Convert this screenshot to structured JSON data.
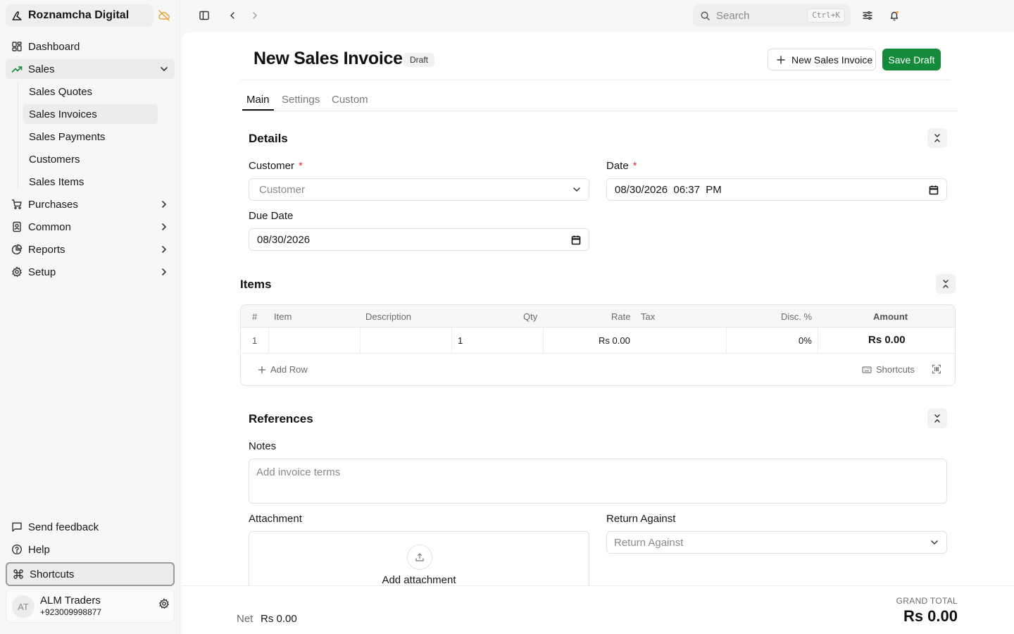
{
  "app": {
    "name": "Roznamcha Digital"
  },
  "sidebar": {
    "items": [
      {
        "label": "Dashboard"
      },
      {
        "label": "Sales"
      },
      {
        "label": "Purchases"
      },
      {
        "label": "Common"
      },
      {
        "label": "Reports"
      },
      {
        "label": "Setup"
      }
    ],
    "sales_sub": [
      {
        "label": "Sales Quotes"
      },
      {
        "label": "Sales Invoices"
      },
      {
        "label": "Sales Payments"
      },
      {
        "label": "Customers"
      },
      {
        "label": "Sales Items"
      }
    ],
    "bottom": [
      {
        "label": "Send feedback"
      },
      {
        "label": "Help"
      },
      {
        "label": "Shortcuts"
      }
    ],
    "profile": {
      "initials": "AT",
      "name": "ALM Traders",
      "phone": "+923009998877"
    }
  },
  "topbar": {
    "search_placeholder": "Search",
    "search_shortcut": "Ctrl+K"
  },
  "page": {
    "title": "New Sales Invoice",
    "status": "Draft",
    "new_button": "New Sales Invoice",
    "save_button": "Save Draft",
    "tabs": [
      {
        "label": "Main"
      },
      {
        "label": "Settings"
      },
      {
        "label": "Custom"
      }
    ]
  },
  "details": {
    "title": "Details",
    "customer_label": "Customer",
    "customer_placeholder": "Customer",
    "date_label": "Date",
    "date_value": "08/30/2026  06:37  PM",
    "due_date_label": "Due Date",
    "due_date_value": "08/30/2026",
    "required_mark": "*"
  },
  "items": {
    "title": "Items",
    "columns": [
      "#",
      "Item",
      "Description",
      "Qty",
      "Rate",
      "Tax",
      "Disc. %",
      "Amount"
    ],
    "rows": [
      {
        "no": "1",
        "item": "",
        "description": "",
        "qty": "1",
        "rate": "Rs 0.00",
        "tax": "",
        "disc": "0%",
        "amount": "Rs 0.00"
      }
    ],
    "add_row": "Add Row",
    "shortcuts": "Shortcuts"
  },
  "references": {
    "title": "References",
    "notes_label": "Notes",
    "notes_placeholder": "Add invoice terms",
    "attachment_label": "Attachment",
    "attachment_button": "Add attachment",
    "return_label": "Return Against",
    "return_placeholder": "Return Against"
  },
  "totals": {
    "net_label": "Net",
    "net_value": "Rs 0.00",
    "grand_total_label": "GRAND TOTAL",
    "grand_total_value": "Rs 0.00"
  },
  "colors": {
    "primary": "#148a3a",
    "required": "#e03131",
    "sidebar_bg": "#f7f7f7",
    "sales_icon": "#148a3a",
    "cloud_icon": "#e8a33b"
  }
}
